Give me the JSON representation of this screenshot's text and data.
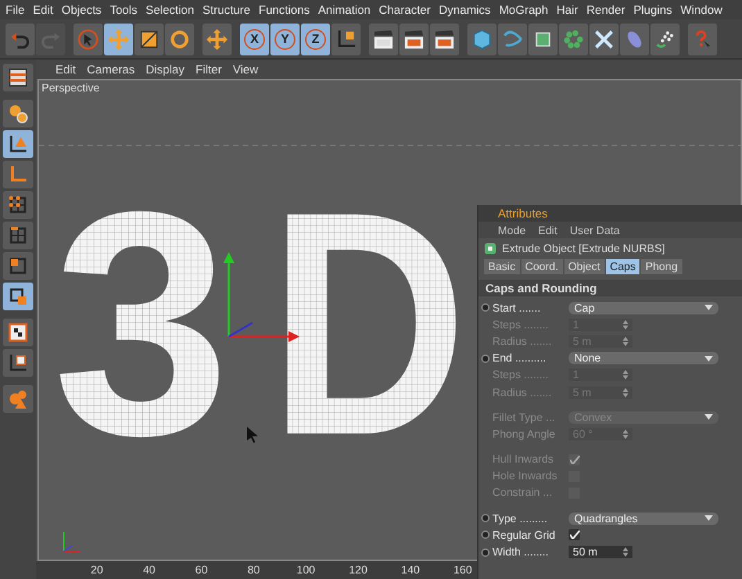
{
  "menu_bar": [
    "File",
    "Edit",
    "Objects",
    "Tools",
    "Selection",
    "Structure",
    "Functions",
    "Animation",
    "Character",
    "Dynamics",
    "MoGraph",
    "Hair",
    "Render",
    "Plugins",
    "Window"
  ],
  "toolbar": [
    {
      "kind": "undo",
      "selected": false,
      "disabled": false
    },
    {
      "kind": "redo",
      "selected": false,
      "disabled": true
    },
    {
      "kind": "select",
      "selected": false,
      "disabled": false
    },
    {
      "kind": "move",
      "selected": true,
      "disabled": false
    },
    {
      "kind": "scale",
      "selected": false,
      "disabled": false
    },
    {
      "kind": "rotate",
      "selected": false,
      "disabled": false
    },
    {
      "kind": "add",
      "selected": false,
      "disabled": false
    },
    {
      "kind": "axis",
      "label": "X",
      "selected": true,
      "disabled": false
    },
    {
      "kind": "axis",
      "label": "Y",
      "selected": true,
      "disabled": false
    },
    {
      "kind": "axis",
      "label": "Z",
      "selected": true,
      "disabled": false
    },
    {
      "kind": "coords",
      "selected": false,
      "disabled": false
    },
    {
      "kind": "render",
      "selected": false,
      "disabled": false
    },
    {
      "kind": "render-view",
      "selected": false,
      "disabled": false
    },
    {
      "kind": "render-settings",
      "selected": false,
      "disabled": false
    },
    {
      "kind": "cube",
      "selected": false,
      "disabled": false
    },
    {
      "kind": "spline",
      "selected": false,
      "disabled": false
    },
    {
      "kind": "nurbs",
      "selected": false,
      "disabled": false
    },
    {
      "kind": "cloner",
      "selected": false,
      "disabled": false
    },
    {
      "kind": "deformer",
      "selected": false,
      "disabled": false
    },
    {
      "kind": "scene",
      "selected": false,
      "disabled": false
    },
    {
      "kind": "particles",
      "selected": false,
      "disabled": false
    },
    {
      "kind": "help",
      "selected": false,
      "disabled": false
    }
  ],
  "side_toolbar": [
    {
      "selected": false
    },
    {
      "selected": false
    },
    {
      "selected": true
    },
    {
      "selected": false
    },
    {
      "selected": false
    },
    {
      "selected": false
    },
    {
      "selected": false
    },
    {
      "selected": true
    },
    {
      "selected": false
    },
    {
      "selected": false
    },
    {
      "selected": false
    }
  ],
  "viewport": {
    "menu": [
      "Edit",
      "Cameras",
      "Display",
      "Filter",
      "View"
    ],
    "camera": "Perspective",
    "model_glyphs": [
      "3",
      "D"
    ]
  },
  "timeline": {
    "ticks": [
      "20",
      "40",
      "60",
      "80",
      "100",
      "120",
      "140",
      "160"
    ]
  },
  "attributes": {
    "title": "Attributes",
    "menu": [
      "Mode",
      "Edit",
      "User Data"
    ],
    "object": "Extrude Object [Extrude NURBS]",
    "tabs": [
      {
        "label": "Basic",
        "selected": false
      },
      {
        "label": "Coord.",
        "selected": false
      },
      {
        "label": "Object",
        "selected": false
      },
      {
        "label": "Caps",
        "selected": true
      },
      {
        "label": "Phong",
        "selected": false
      }
    ],
    "section": "Caps and Rounding",
    "params": [
      {
        "kind": "dropdown",
        "label": "Start",
        "dots": ".......",
        "value": "Cap",
        "disabled": false,
        "animatable": true
      },
      {
        "kind": "number",
        "label": "Steps",
        "dots": "........",
        "value": "1",
        "disabled": true,
        "animatable": false
      },
      {
        "kind": "number",
        "label": "Radius",
        "dots": ".......",
        "value": "5 m",
        "disabled": true,
        "animatable": false
      },
      {
        "kind": "dropdown",
        "label": "End",
        "dots": "..........",
        "value": "None",
        "disabled": false,
        "animatable": true
      },
      {
        "kind": "number",
        "label": "Steps",
        "dots": "........",
        "value": "1",
        "disabled": true,
        "animatable": false
      },
      {
        "kind": "number",
        "label": "Radius",
        "dots": ".......",
        "value": "5 m",
        "disabled": true,
        "animatable": false
      },
      {
        "kind": "gap"
      },
      {
        "kind": "dropdown",
        "label": "Fillet Type",
        "dots": "...",
        "value": "Convex",
        "disabled": true,
        "animatable": false
      },
      {
        "kind": "number",
        "label": "Phong Angle",
        "value": "60 °",
        "disabled": true,
        "animatable": false
      },
      {
        "kind": "gap"
      },
      {
        "kind": "checkbox",
        "label": "Hull Inwards",
        "checked": true,
        "disabled": true,
        "animatable": false
      },
      {
        "kind": "checkbox",
        "label": "Hole Inwards",
        "checked": false,
        "disabled": true,
        "animatable": false
      },
      {
        "kind": "checkbox",
        "label": "Constrain",
        "dots": "...",
        "checked": false,
        "disabled": true,
        "animatable": false
      },
      {
        "kind": "gap"
      },
      {
        "kind": "dropdown",
        "label": "Type",
        "dots": ".........",
        "value": "Quadrangles",
        "disabled": false,
        "animatable": true
      },
      {
        "kind": "checkbox",
        "label": "Regular Grid",
        "checked": true,
        "disabled": false,
        "animatable": true
      },
      {
        "kind": "number",
        "label": "Width",
        "dots": "........",
        "value": "50 m",
        "disabled": false,
        "animatable": true
      }
    ]
  }
}
